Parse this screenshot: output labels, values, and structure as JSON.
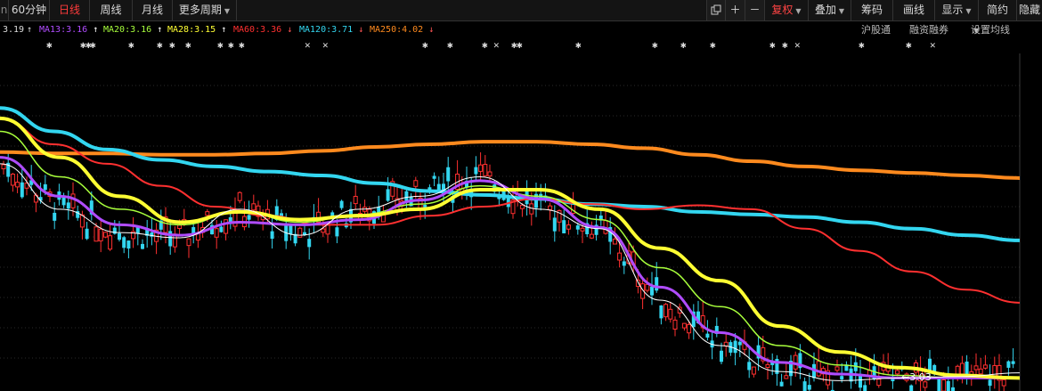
{
  "toolbar": {
    "left_items": [
      "60分钟",
      "日线",
      "周线",
      "月线",
      "更多周期"
    ],
    "active_item": "日线",
    "right_items": [
      "复权",
      "叠加",
      "筹码",
      "画线",
      "显示",
      "简约",
      "隐藏"
    ],
    "plus_icon": "plus-icon",
    "minus_icon": "minus-icon",
    "copy_icon": "copy-icon"
  },
  "legend": {
    "first_value": "3.19",
    "items": [
      {
        "label": "MA13:3.16",
        "arrow": "↑",
        "color": "#b04cff"
      },
      {
        "label": "MA20:3.16",
        "arrow": "↑",
        "color": "#a8ff3c"
      },
      {
        "label": "MA28:3.15",
        "arrow": "↑",
        "color": "#ffff33"
      },
      {
        "label": "MA60:3.36",
        "arrow": "↓",
        "color": "#ff3030"
      },
      {
        "label": "MA120:3.71",
        "arrow": "↓",
        "color": "#33d6f0"
      },
      {
        "label": "MA250:4.02",
        "arrow": "↓",
        "color": "#ff8a1e"
      }
    ],
    "links": [
      "沪股通",
      "融资融券",
      "设置均线"
    ]
  },
  "markers": [
    "✱",
    "✱✱✱",
    "✱",
    "✱",
    "✱",
    "✱",
    "✱",
    "✱",
    "✱",
    "✱",
    "✱",
    "✕",
    "✕",
    "✱",
    "✱",
    "✱✱",
    "✕",
    "✱",
    "✱",
    "✱",
    "✱",
    "✱",
    "✱",
    "✱",
    "✱",
    "✕",
    "✱",
    "✱",
    "✕"
  ],
  "chart_data": {
    "type": "candlestick",
    "annotation": "3.03",
    "colors": {
      "up": "#ff3030",
      "down": "#33d6f0",
      "MA5": "#ffffff",
      "MA13": "#b04cff",
      "MA20": "#a8ff3c",
      "MA28": "#ffff33",
      "MA60": "#ff3030",
      "MA120": "#33d6f0",
      "MA250": "#ff8a1e"
    },
    "ma250": [
      4.04,
      4.03,
      4.03,
      4.02,
      4.02,
      4.03,
      4.05,
      4.08,
      4.1,
      4.12,
      4.12,
      4.1,
      4.07,
      4.02,
      3.97,
      3.93,
      3.9,
      3.88,
      3.86,
      3.84
    ],
    "ma120": [
      4.38,
      4.2,
      4.06,
      3.98,
      3.93,
      3.89,
      3.86,
      3.8,
      3.74,
      3.71,
      3.68,
      3.64,
      3.62,
      3.58,
      3.56,
      3.54,
      3.5,
      3.45,
      3.4,
      3.36
    ],
    "ma60": [
      4.3,
      4.1,
      3.95,
      3.78,
      3.62,
      3.55,
      3.48,
      3.48,
      3.55,
      3.62,
      3.68,
      3.64,
      3.6,
      3.63,
      3.6,
      3.45,
      3.28,
      3.12,
      2.98,
      2.88
    ],
    "ma28": [
      4.3,
      4.0,
      3.7,
      3.5,
      3.58,
      3.52,
      3.55,
      3.6,
      3.75,
      3.75,
      3.6,
      3.3,
      3.05,
      2.7,
      2.5,
      2.38,
      2.32,
      2.3
    ],
    "ma20": [
      4.2,
      3.85,
      3.6,
      3.48,
      3.58,
      3.5,
      3.56,
      3.64,
      3.78,
      3.7,
      3.52,
      3.15,
      2.85,
      2.55,
      2.4,
      2.32,
      2.3,
      2.3
    ],
    "ma13": [
      4.0,
      3.7,
      3.48,
      3.4,
      3.5,
      3.48,
      3.52,
      3.67,
      3.82,
      3.68,
      3.46,
      3.0,
      2.65,
      2.42,
      2.33,
      2.3,
      2.3,
      2.3
    ],
    "ma5": [
      3.95,
      3.6,
      3.42,
      3.38,
      3.6,
      3.4,
      3.6,
      3.7,
      3.85,
      3.6,
      3.45,
      2.9,
      2.55,
      2.35,
      2.28,
      2.3,
      2.31,
      2.34
    ],
    "price_range": [
      2.2,
      4.8
    ]
  }
}
